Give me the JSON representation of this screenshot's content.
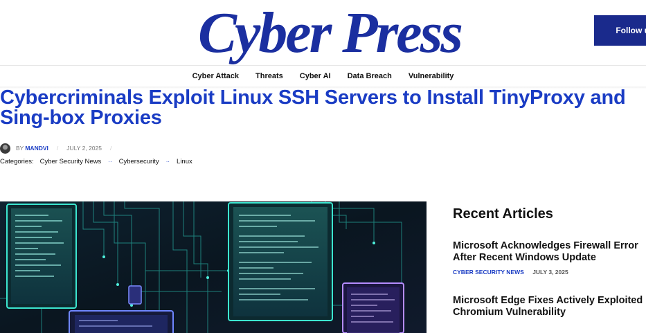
{
  "header": {
    "logo_text": "Cyber Press",
    "follow_label": "Follow us"
  },
  "nav": {
    "items": [
      {
        "label": "Cyber Attack"
      },
      {
        "label": "Threats"
      },
      {
        "label": "Cyber AI"
      },
      {
        "label": "Data Breach"
      },
      {
        "label": "Vulnerability"
      }
    ]
  },
  "article": {
    "title": "Cybercriminals Exploit Linux SSH Servers to Install TinyProxy and Sing-box Proxies",
    "by_label": "BY",
    "author": "MANDVI",
    "date": "JULY 2, 2025",
    "categories_label": "Categories:",
    "categories": [
      "Cyber Security News",
      "Cybersecurity",
      "Linux"
    ],
    "category_separator": "··"
  },
  "sidebar": {
    "title": "Recent Articles",
    "articles": [
      {
        "title": "Microsoft Acknowledges Firewall Error After Recent Windows Update",
        "category": "CYBER SECURITY NEWS",
        "date": "JULY 3, 2025"
      },
      {
        "title": "Microsoft Edge Fixes Actively Exploited Chromium Vulnerability"
      }
    ]
  },
  "colors": {
    "brand_blue": "#1a3cc4",
    "logo_blue": "#1b2fa0",
    "button_navy": "#1a2a8c"
  }
}
